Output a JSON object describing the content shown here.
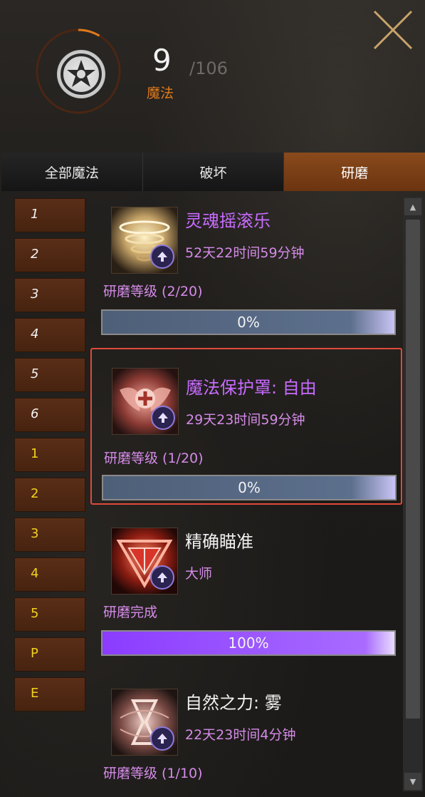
{
  "header": {
    "count": "9",
    "total": "/106",
    "label": "魔法",
    "progress": 0.085
  },
  "tabs": [
    {
      "label": "全部魔法",
      "active": false
    },
    {
      "label": "破坏",
      "active": false
    },
    {
      "label": "研磨",
      "active": true
    }
  ],
  "levels": [
    "1",
    "2",
    "3",
    "4",
    "5",
    "6",
    "1",
    "2",
    "3",
    "4",
    "5",
    "P",
    "E"
  ],
  "cards": [
    {
      "name": "灵魂摇滚乐",
      "time": "52天22时间59分钟",
      "level": "研磨等级 (2/20)",
      "progress_text": "0%",
      "progress": 0.0,
      "name_color": "#c86bff",
      "icon": "soul-rock-icon"
    },
    {
      "name": "魔法保护罩: 自由",
      "time": "29天23时间59分钟",
      "level": "研磨等级 (1/20)",
      "progress_text": "0%",
      "progress": 0.0,
      "name_color": "#c86bff",
      "icon": "magic-shield-icon"
    },
    {
      "name": "精确瞄准",
      "time": "大师",
      "level": "研磨完成",
      "progress_text": "100%",
      "progress": 1.0,
      "name_color": "#f0f0f0",
      "icon": "precise-aim-icon"
    },
    {
      "name": "自然之力: 雾",
      "time": "22天23时间4分钟",
      "level": "研磨等级 (1/10)",
      "progress_text": "",
      "progress": null,
      "name_color": "#f0f0f0",
      "icon": "nature-mist-icon"
    }
  ],
  "colors": {
    "accent": "#e07a1a",
    "tab_active": "#7a3d14",
    "purple_fill": "#8b3cff",
    "empty_fill": "#4e5f78",
    "selection": "#e04a3a"
  }
}
